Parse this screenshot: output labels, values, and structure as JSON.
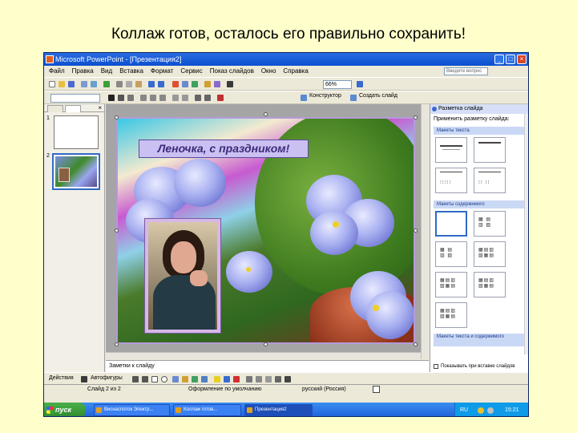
{
  "caption": "Коллаж готов, осталось его правильно сохранить!",
  "window": {
    "title": "Microsoft PowerPoint - [Презентация2]"
  },
  "menu": {
    "items": [
      "Файл",
      "Правка",
      "Вид",
      "Вставка",
      "Формат",
      "Сервис",
      "Показ слайдов",
      "Окно",
      "Справка"
    ],
    "help_placeholder": "Введите вопрос"
  },
  "toolbar": {
    "zoom": "66%",
    "designer_label": "Конструктор",
    "new_slide_label": "Создать слайд"
  },
  "slides_pane": {
    "slide_numbers": [
      "1",
      "2"
    ]
  },
  "slide": {
    "headline": "Леночка, с праздником!"
  },
  "notes": {
    "placeholder": "Заметки к слайду"
  },
  "task_pane": {
    "title": "Разметка слайда",
    "apply_label": "Применить разметку слайда:",
    "section_text": "Макеты текста",
    "section_content": "Макеты содержимого",
    "section_text_content": "Макеты текста и содержимого",
    "footer_checkbox": "Показывать при вставке слайдов"
  },
  "draw_toolbar": {
    "actions_label": "Действия",
    "autoshapes_label": "Автофигуры"
  },
  "status": {
    "slide": "Слайд 2 из 2",
    "design": "Оформление по умолчанию",
    "language": "русский (Россия)"
  },
  "taskbar": {
    "start_label": "пуск",
    "tasks": [
      "Виснаспоток Электр...",
      "Коллаж готов...",
      "Презентация2"
    ],
    "language": "RU",
    "clock": "15:21"
  },
  "colors": {
    "title_bar": "#0a4fd0",
    "caption_bg": "#ffffcc",
    "slide_border": "#b49ad8",
    "headline_bg": "#cbc0f2"
  }
}
